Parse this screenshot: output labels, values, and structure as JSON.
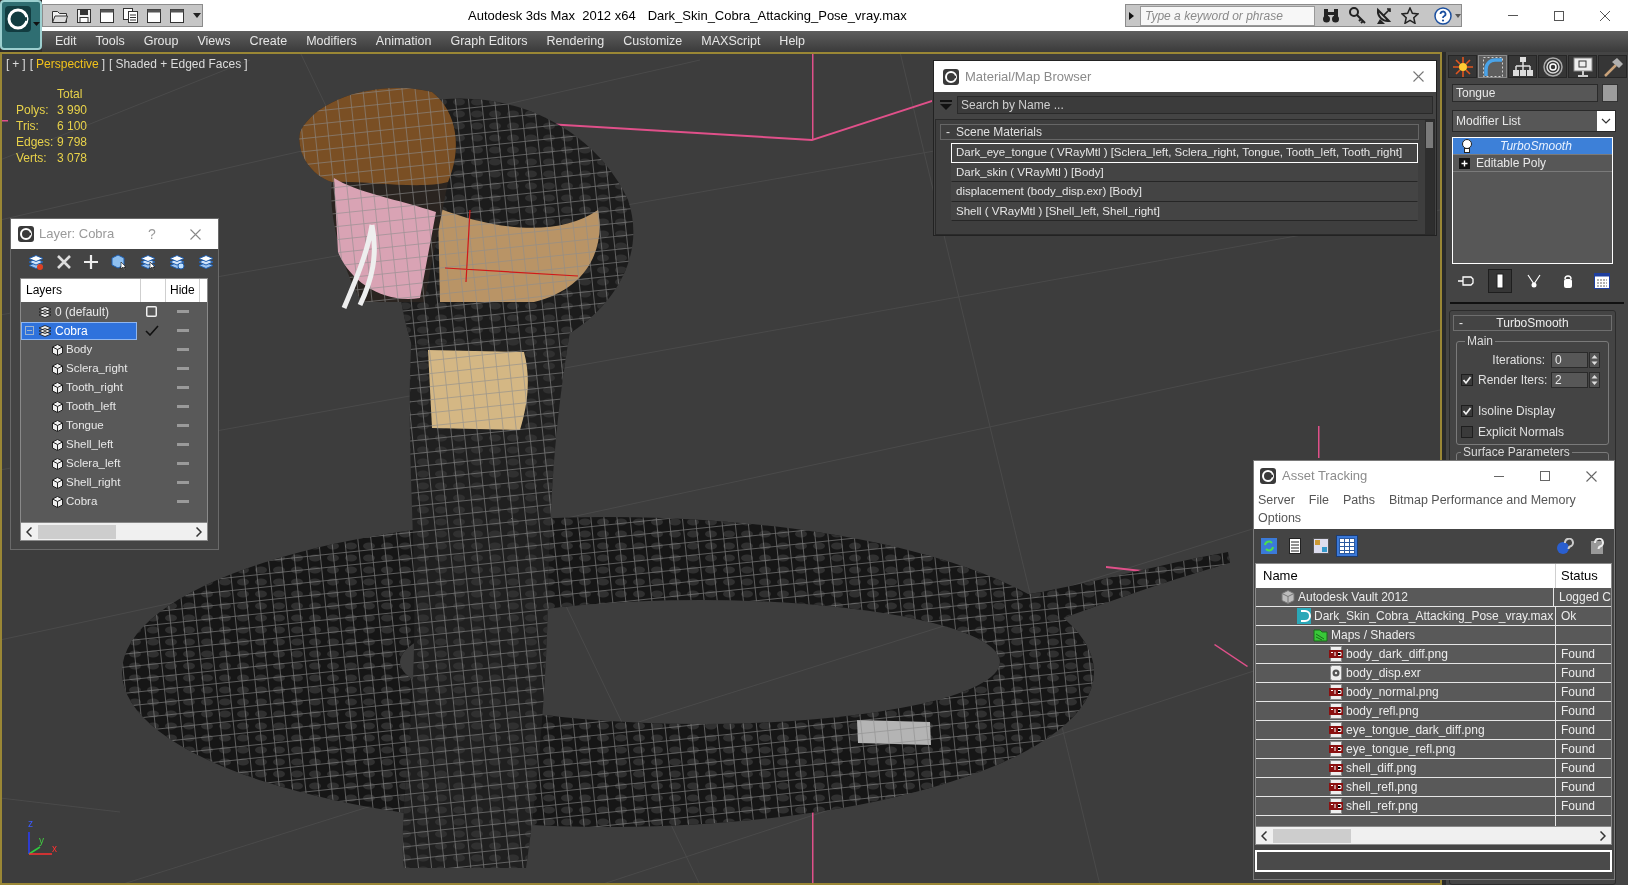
{
  "window": {
    "app_title": "Autodesk 3ds Max  2012 x64",
    "file_title": "Dark_Skin_Cobra_Attacking_Pose_vray.max"
  },
  "search": {
    "placeholder": "Type a keyword or phrase"
  },
  "menu": [
    "Edit",
    "Tools",
    "Group",
    "Views",
    "Create",
    "Modifiers",
    "Animation",
    "Graph Editors",
    "Rendering",
    "Customize",
    "MAXScript",
    "Help"
  ],
  "viewport": {
    "labels": [
      {
        "open": "[",
        "text": "+",
        "close": "]",
        "highlighted": false
      },
      {
        "open": "[",
        "text": "Perspective",
        "close": "]",
        "highlighted": true
      },
      {
        "open": "[",
        "text": "Shaded + Edged Faces",
        "close": "]",
        "highlighted": false
      }
    ],
    "stats": {
      "heading": "Total",
      "rows": [
        {
          "label": "Polys:",
          "value": "3 990"
        },
        {
          "label": "Tris:",
          "value": "6 100"
        },
        {
          "label": "Edges:",
          "value": "9 798"
        },
        {
          "label": "Verts:",
          "value": "3 078"
        }
      ]
    },
    "axis_labels": [
      "x",
      "y",
      "z"
    ]
  },
  "layer_dialog": {
    "title": "Layer: Cobra",
    "help": "?",
    "columns": [
      "Layers",
      "Hide"
    ],
    "layers": [
      {
        "name": "0 (default)",
        "selected": false,
        "current": false,
        "hidden": false
      },
      {
        "name": "Cobra",
        "selected": true,
        "current": true,
        "hidden": false,
        "expanded": true,
        "children": [
          {
            "name": "Body",
            "selected": false,
            "hidden": false
          },
          {
            "name": "Sclera_right",
            "selected": false,
            "hidden": false
          },
          {
            "name": "Tooth_right",
            "selected": false,
            "hidden": false
          },
          {
            "name": "Tooth_left",
            "selected": false,
            "hidden": false
          },
          {
            "name": "Tongue",
            "selected": false,
            "hidden": false
          },
          {
            "name": "Shell_left",
            "selected": false,
            "hidden": false
          },
          {
            "name": "Sclera_left",
            "selected": false,
            "hidden": false
          },
          {
            "name": "Shell_right",
            "selected": false,
            "hidden": false
          },
          {
            "name": "Cobra",
            "selected": false,
            "hidden": false
          }
        ]
      }
    ]
  },
  "material_browser": {
    "title": "Material/Map Browser",
    "search_placeholder": "Search by Name ...",
    "group": {
      "toggle": "-",
      "title": "Scene Materials",
      "items": [
        {
          "text": "Dark_eye_tongue ( VRayMtl ) [Sclera_left, Sclera_right, Tongue, Tooth_left, Tooth_right]",
          "selected": true
        },
        {
          "text": "Dark_skin ( VRayMtl ) [Body]",
          "selected": false
        },
        {
          "text": "displacement (body_disp.exr) [Body]",
          "selected": false
        },
        {
          "text": "Shell ( VRayMtl ) [Shell_left, Shell_right]",
          "selected": false
        }
      ]
    }
  },
  "command_panel": {
    "tabs": [
      {
        "kind": "create",
        "selected": false
      },
      {
        "kind": "modify",
        "selected": true
      },
      {
        "kind": "hierarchy",
        "selected": false
      },
      {
        "kind": "motion",
        "selected": false
      },
      {
        "kind": "display",
        "selected": false
      },
      {
        "kind": "utilities",
        "selected": false
      }
    ],
    "object_name": "Tongue",
    "modifier_list": "Modifier List",
    "stack": [
      {
        "name": "TurboSmooth",
        "kind": "modifier",
        "selected": true
      },
      {
        "name": "Editable Poly",
        "kind": "object",
        "selected": false
      }
    ],
    "stack_buttons": [
      {
        "kind": "pin",
        "on": false
      },
      {
        "kind": "end_result",
        "on": true
      },
      {
        "kind": "unique",
        "on": false
      },
      {
        "kind": "remove",
        "on": false
      },
      {
        "kind": "configure",
        "on": false
      }
    ],
    "rollout": {
      "toggle": "-",
      "title": "TurboSmooth",
      "group": "Main",
      "fields": [
        {
          "kind": "spinner",
          "label": "Iterations:",
          "value": "0"
        },
        {
          "kind": "check_spinner",
          "label": "Render Iters:",
          "checked": true,
          "value": "2"
        },
        {
          "kind": "checkbox",
          "label": "Isoline Display",
          "checked": true
        },
        {
          "kind": "checkbox",
          "label": "Explicit Normals",
          "checked": false
        }
      ],
      "next_group": "Surface Parameters"
    }
  },
  "asset_tracking": {
    "title": "Asset Tracking",
    "menu": [
      "Server",
      "File",
      "Paths",
      "Bitmap Performance and Memory",
      "Options"
    ],
    "toolbar": [
      {
        "kind": "refresh",
        "selected": false
      },
      {
        "kind": "list",
        "selected": false
      },
      {
        "kind": "thumbnails",
        "selected": false
      },
      {
        "kind": "table",
        "selected": true
      }
    ],
    "columns": [
      "Name",
      "Status"
    ],
    "tree": [
      {
        "kind": "vault",
        "name": "Autodesk Vault 2012",
        "status": "Logged C",
        "children": [
          {
            "kind": "max",
            "name": "Dark_Skin_Cobra_Attacking_Pose_vray.max",
            "status": "Ok",
            "children": [
              {
                "kind": "folder",
                "name": "Maps / Shaders",
                "children": [
                  {
                    "kind": "png",
                    "name": "body_dark_diff.png",
                    "status": "Found"
                  },
                  {
                    "kind": "exr",
                    "name": "body_disp.exr",
                    "status": "Found"
                  },
                  {
                    "kind": "png",
                    "name": "body_normal.png",
                    "status": "Found"
                  },
                  {
                    "kind": "png",
                    "name": "body_refl.png",
                    "status": "Found"
                  },
                  {
                    "kind": "png",
                    "name": "eye_tongue_dark_diff.png",
                    "status": "Found"
                  },
                  {
                    "kind": "png",
                    "name": "eye_tongue_refl.png",
                    "status": "Found"
                  },
                  {
                    "kind": "png",
                    "name": "shell_diff.png",
                    "status": "Found"
                  },
                  {
                    "kind": "png",
                    "name": "shell_refl.png",
                    "status": "Found"
                  },
                  {
                    "kind": "png",
                    "name": "shell_refr.png",
                    "status": "Found"
                  }
                ]
              }
            ]
          }
        ]
      }
    ]
  }
}
